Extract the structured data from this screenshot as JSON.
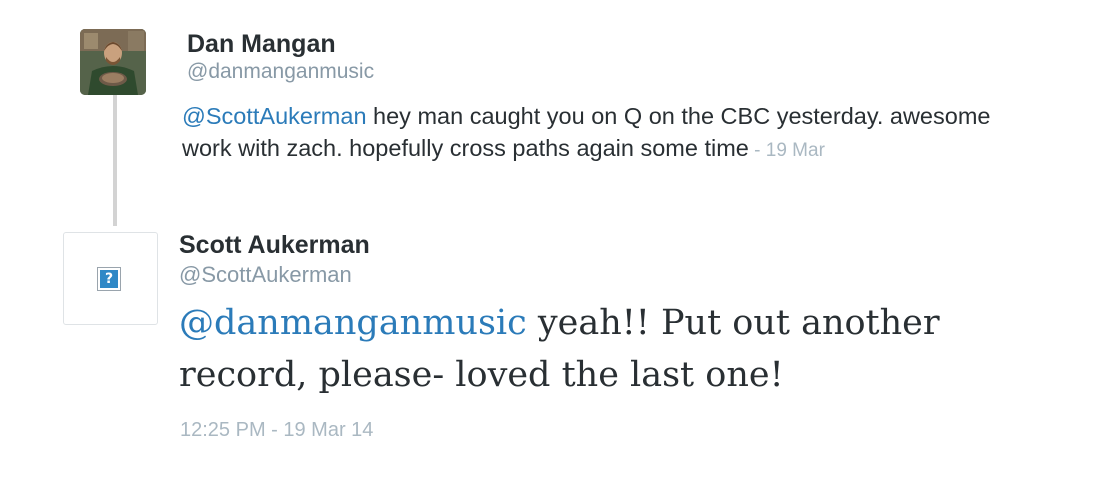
{
  "thread": {
    "parent": {
      "name": "Dan Mangan",
      "handle": "@danmanganmusic",
      "mention": "@ScottAukerman",
      "text": " hey man caught you on Q on the CBC yesterday. awesome work with zach. hopefully cross paths again some time",
      "date": " - 19 Mar",
      "avatar": "profile-photo"
    },
    "reply": {
      "name": "Scott Aukerman",
      "handle": "@ScottAukerman",
      "mention": "@danmanganmusic",
      "text": " yeah!! Put out another record, please- loved the last one!",
      "timestamp": "12:25 PM - 19 Mar 14",
      "avatar": "broken-image-icon"
    }
  },
  "colors": {
    "link": "#2b7bb9",
    "name": "#292f33",
    "handle": "#8899a6",
    "date": "#aab8c2",
    "thread_line": "#d3d3d3"
  }
}
